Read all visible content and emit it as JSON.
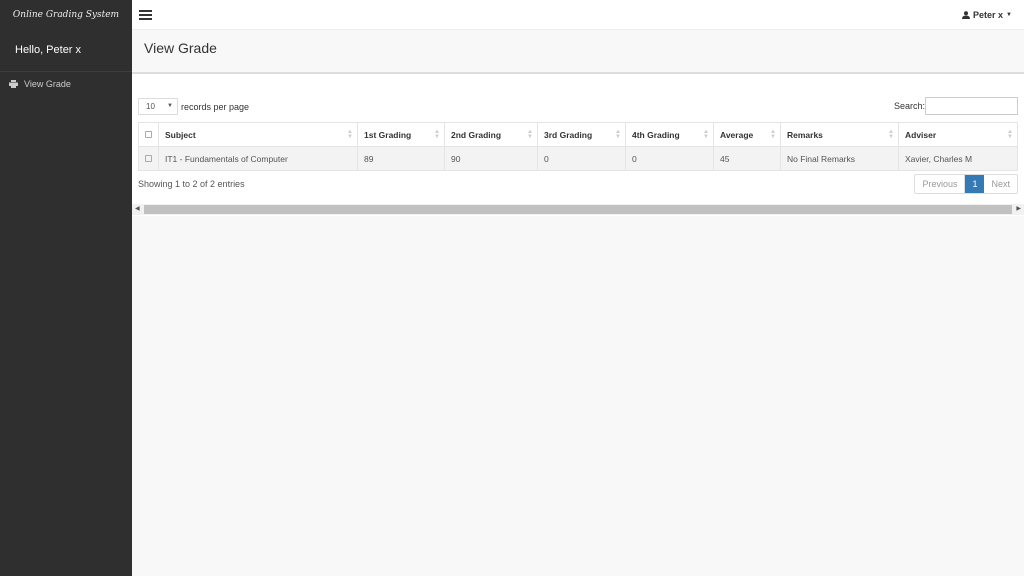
{
  "app": {
    "brand": "Online Grading System",
    "greeting": "Hello, Peter x"
  },
  "sidebar": {
    "items": [
      {
        "label": "View Grade",
        "icon": "print-icon"
      }
    ]
  },
  "topbar": {
    "user": "Peter x"
  },
  "page": {
    "title": "View Grade"
  },
  "table_controls": {
    "length_value": "10",
    "length_label": "records per page",
    "search_label": "Search:",
    "search_value": ""
  },
  "table": {
    "columns": [
      "Subject",
      "1st Grading",
      "2nd Grading",
      "3rd Grading",
      "4th Grading",
      "Average",
      "Remarks",
      "Adviser"
    ],
    "rows": [
      [
        "IT1 - Fundamentals of Computer",
        "89",
        "90",
        "0",
        "0",
        "45",
        "No Final Remarks",
        "Xavier, Charles M"
      ]
    ]
  },
  "footer": {
    "info": "Showing 1 to 2 of 2 entries",
    "previous": "Previous",
    "page": "1",
    "next": "Next"
  },
  "colors": {
    "sidebar": "#2f2f2f",
    "accent": "#337ab7"
  }
}
